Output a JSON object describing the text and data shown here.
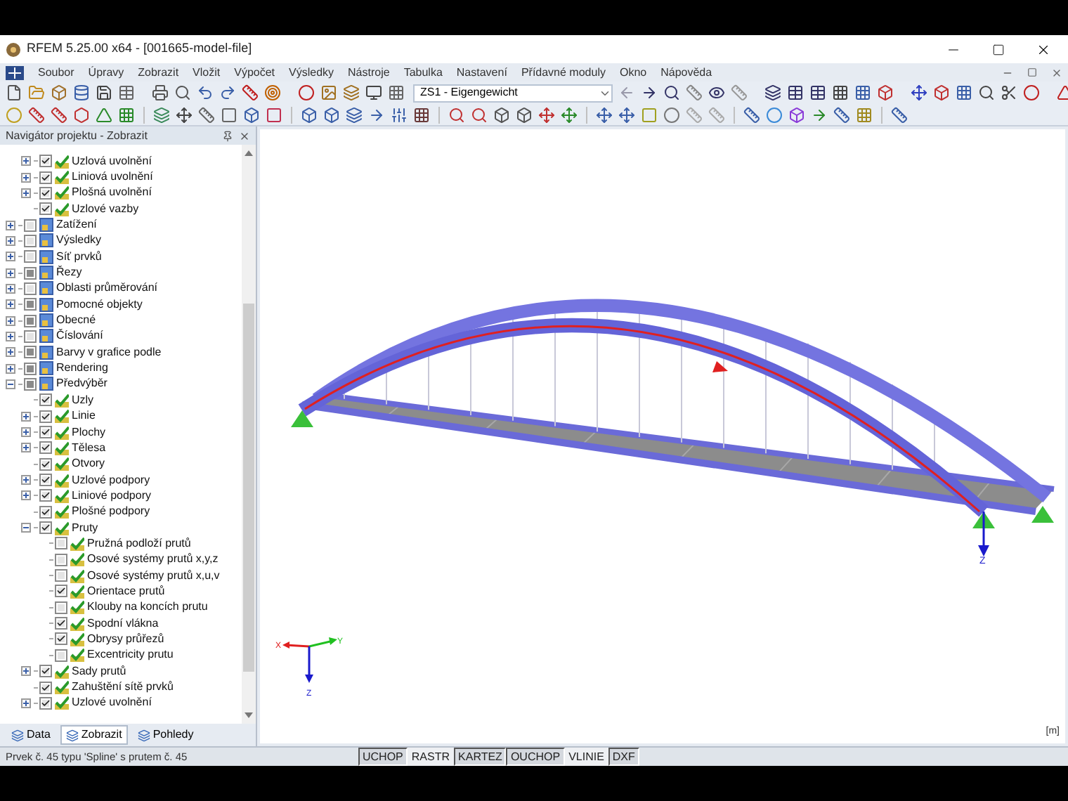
{
  "window": {
    "title": "RFEM 5.25.00 x64 - [001665-model-file]"
  },
  "menu": [
    "Soubor",
    "Úpravy",
    "Zobrazit",
    "Vložit",
    "Výpočet",
    "Výsledky",
    "Nástroje",
    "Tabulka",
    "Nastavení",
    "Přídavné moduly",
    "Okno",
    "Nápověda"
  ],
  "toolbar": {
    "load_case": "ZS1 - Eigengewicht"
  },
  "navigator": {
    "title": "Navigátor projektu - Zobrazit",
    "continued_children": [
      {
        "label": "Uzlová uvolnění",
        "checked": true,
        "indeterminate": false,
        "expanded": false
      },
      {
        "label": "Liniová uvolnění",
        "checked": true,
        "indeterminate": false,
        "expanded": false
      },
      {
        "label": "Plošná uvolnění",
        "checked": true,
        "indeterminate": false,
        "expanded": false
      },
      {
        "label": "Uzlové vazby",
        "checked": true,
        "indeterminate": false
      }
    ],
    "items": [
      {
        "label": "Zatížení",
        "checked": false,
        "indeterminate": false,
        "expanded": false
      },
      {
        "label": "Výsledky",
        "checked": false,
        "indeterminate": false,
        "expanded": false
      },
      {
        "label": "Síť prvků",
        "checked": false,
        "indeterminate": false,
        "expanded": false
      },
      {
        "label": "Řezy",
        "checked": false,
        "indeterminate": true,
        "expanded": false
      },
      {
        "label": "Oblasti průměrování",
        "checked": false,
        "indeterminate": false,
        "expanded": false
      },
      {
        "label": "Pomocné objekty",
        "checked": false,
        "indeterminate": true,
        "expanded": false
      },
      {
        "label": "Obecné",
        "checked": false,
        "indeterminate": true,
        "expanded": false
      },
      {
        "label": "Číslování",
        "checked": false,
        "indeterminate": false,
        "expanded": false
      },
      {
        "label": "Barvy v grafice podle",
        "checked": false,
        "indeterminate": true,
        "expanded": false
      },
      {
        "label": "Rendering",
        "checked": false,
        "indeterminate": true,
        "expanded": false
      },
      {
        "label": "Předvýběr",
        "checked": false,
        "indeterminate": true,
        "expanded": true,
        "children": [
          {
            "label": "Uzly",
            "checked": true,
            "indeterminate": false
          },
          {
            "label": "Linie",
            "checked": true,
            "indeterminate": false,
            "expanded": false
          },
          {
            "label": "Plochy",
            "checked": true,
            "indeterminate": false,
            "expanded": false
          },
          {
            "label": "Tělesa",
            "checked": true,
            "indeterminate": false,
            "expanded": false
          },
          {
            "label": "Otvory",
            "checked": true,
            "indeterminate": false
          },
          {
            "label": "Uzlové podpory",
            "checked": true,
            "indeterminate": false,
            "expanded": false
          },
          {
            "label": "Liniové podpory",
            "checked": true,
            "indeterminate": false,
            "expanded": false
          },
          {
            "label": "Plošné podpory",
            "checked": true,
            "indeterminate": false
          },
          {
            "label": "Pruty",
            "checked": true,
            "indeterminate": false,
            "expanded": true,
            "children": [
              {
                "label": "Pružná podloží prutů",
                "checked": false,
                "indeterminate": false
              },
              {
                "label": "Osové systémy prutů x,y,z",
                "checked": false,
                "indeterminate": false
              },
              {
                "label": "Osové systémy prutů x,u,v",
                "checked": false,
                "indeterminate": false
              },
              {
                "label": "Orientace prutů",
                "checked": true,
                "indeterminate": false
              },
              {
                "label": "Klouby na koncích prutu",
                "checked": false,
                "indeterminate": false
              },
              {
                "label": "Spodní vlákna",
                "checked": true,
                "indeterminate": false
              },
              {
                "label": "Obrysy průřezů",
                "checked": true,
                "indeterminate": false
              },
              {
                "label": "Excentricity prutu",
                "checked": false,
                "indeterminate": false
              }
            ]
          },
          {
            "label": "Sady prutů",
            "checked": true,
            "indeterminate": false,
            "expanded": false
          },
          {
            "label": "Zahuštění sítě prvků",
            "checked": true,
            "indeterminate": false
          },
          {
            "label": "Uzlové uvolnění",
            "checked": true,
            "indeterminate": false,
            "expanded": false
          }
        ]
      }
    ],
    "tabs": [
      {
        "label": "Data",
        "selected": false
      },
      {
        "label": "Zobrazit",
        "selected": true
      },
      {
        "label": "Pohledy",
        "selected": false
      }
    ]
  },
  "viewport": {
    "support_axis_label": "Z",
    "triad": {
      "x": "X",
      "y": "Y",
      "z": "Z"
    },
    "unit": "[m]"
  },
  "status_bar": {
    "message": "Prvek č. 45 typu 'Spline' s prutem č. 45",
    "toggles": [
      {
        "label": "UCHOP",
        "on": true
      },
      {
        "label": "RASTR",
        "on": false
      },
      {
        "label": "KARTEZ",
        "on": true
      },
      {
        "label": "OUCHOP",
        "on": true
      },
      {
        "label": "VLINIE",
        "on": false
      },
      {
        "label": "DXF",
        "on": true
      }
    ]
  }
}
